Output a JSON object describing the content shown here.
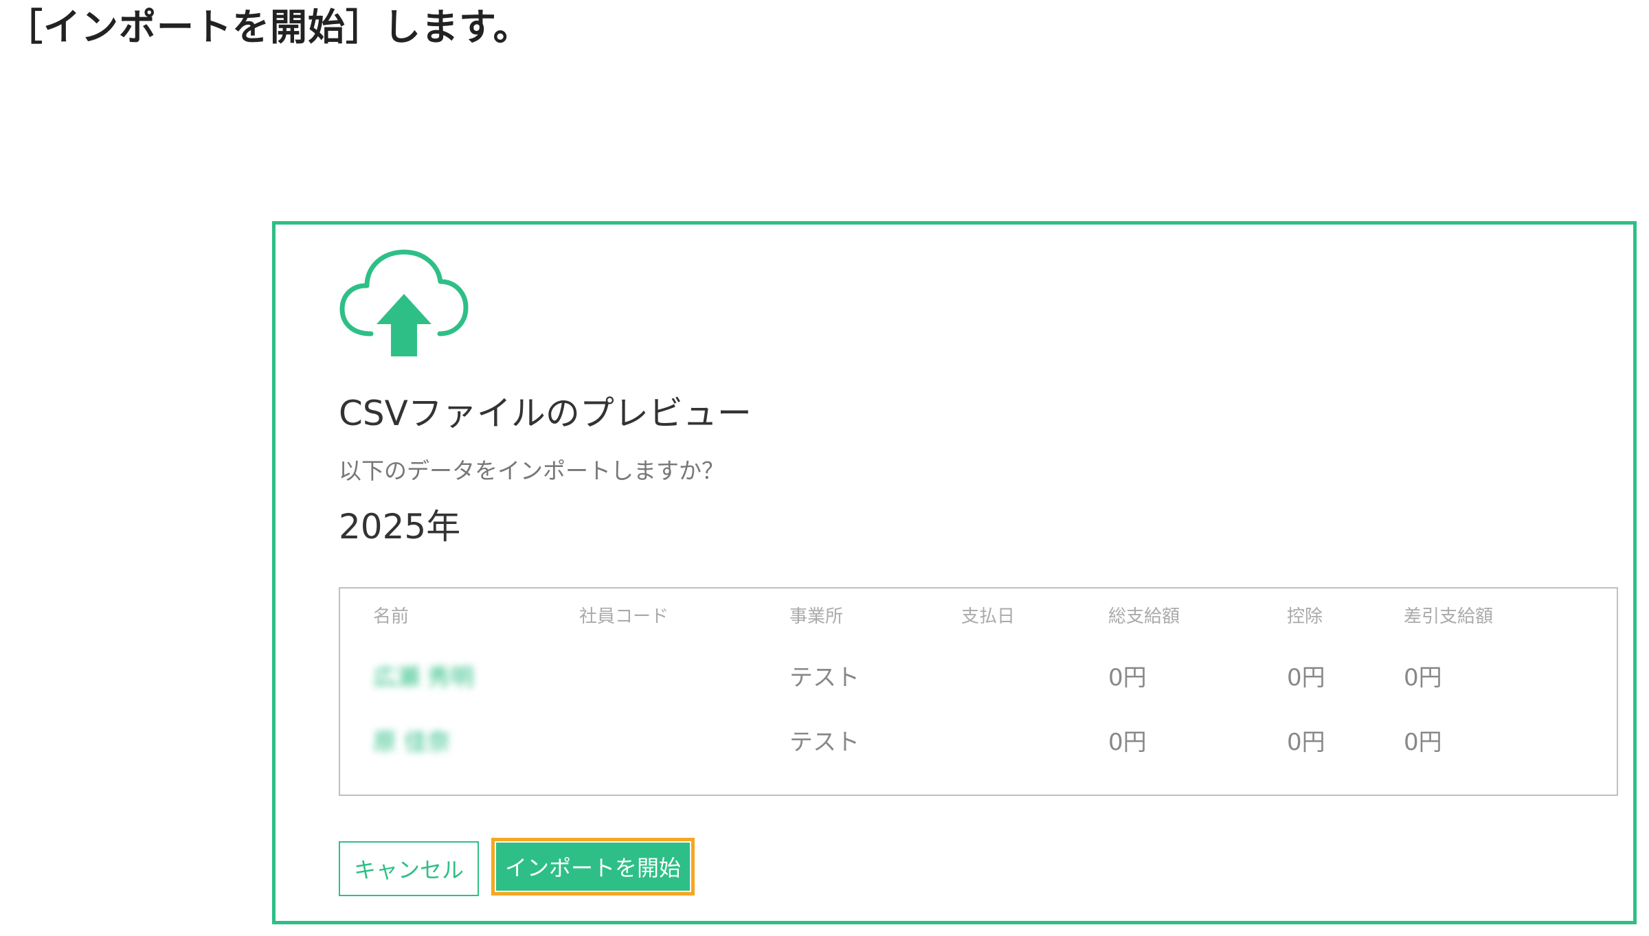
{
  "instruction": "［インポートを開始］します。",
  "dialog": {
    "icon": "cloud-upload-icon",
    "title": "CSVファイルのプレビュー",
    "prompt": "以下のデータをインポートしますか？",
    "year": "2025年"
  },
  "table": {
    "headers": {
      "name": "名前",
      "employee_code": "社員コード",
      "office": "事業所",
      "pay_date": "支払日",
      "gross_pay": "総支給額",
      "deduction": "控除",
      "net_pay": "差引支給額"
    },
    "rows": [
      {
        "name": "広瀬 秀明",
        "employee_code": "",
        "office": "テスト",
        "pay_date": "",
        "gross_pay": "0円",
        "deduction": "0円",
        "net_pay": "0円"
      },
      {
        "name": "原 佳奈",
        "employee_code": "",
        "office": "テスト",
        "pay_date": "",
        "gross_pay": "0円",
        "deduction": "0円",
        "net_pay": "0円"
      }
    ]
  },
  "buttons": {
    "cancel": "キャンセル",
    "start_import": "インポートを開始"
  },
  "colors": {
    "accent": "#2ebf86",
    "highlight": "#f5a623"
  }
}
